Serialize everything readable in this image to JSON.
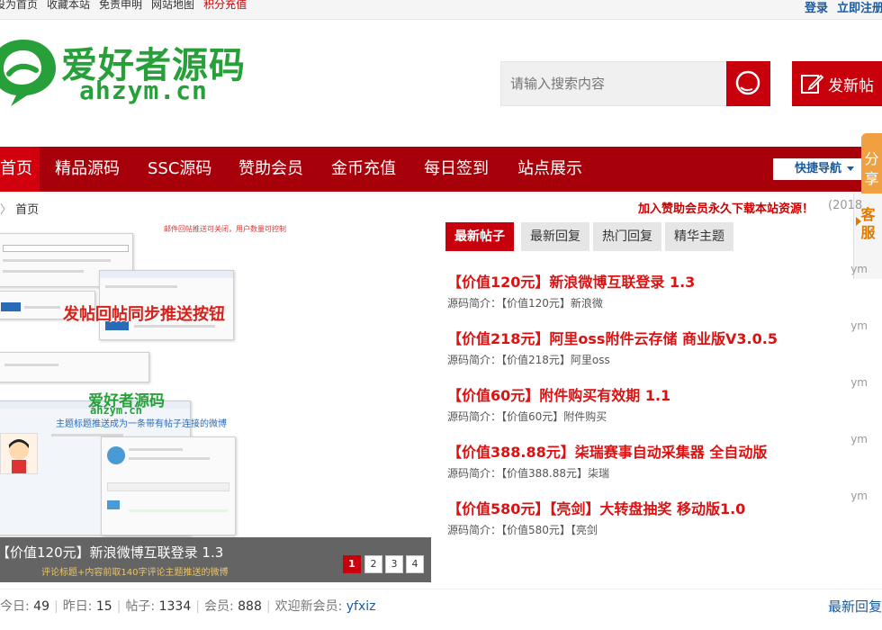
{
  "topbar": {
    "links": [
      "设为首页",
      "收藏本站",
      "免责申明",
      "网站地图",
      "积分充值"
    ],
    "login": "登录",
    "register": "立即注册"
  },
  "logo": {
    "cn": "爱好者源码",
    "en": "ahzym.cn"
  },
  "search": {
    "placeholder": "请输入搜索内容"
  },
  "post_button": "发新帖",
  "nav": {
    "items": [
      "首页",
      "精品源码",
      "SSC源码",
      "赞助会员",
      "金币充值",
      "每日签到",
      "站点展示"
    ],
    "quick": "快捷导航"
  },
  "side": {
    "share": "分享",
    "service": "客服"
  },
  "breadcrumb": "首页",
  "announcement": "加入赞助会员永久下载本站资源！",
  "announcement_date": "(2018",
  "slider": {
    "caption": "【价值120元】新浪微博互联登录 1.3",
    "caption_sub": "评论标题+内容前取140字评论主题推送的微博",
    "hint": "邮件回帖推送可关闭，用户数量可控制",
    "image_text_main": "发帖回帖同步推送按钮",
    "image_text_note": "主题标题推送成为一条带有帖子连接的微博",
    "watermark_cn": "爱好者源码",
    "watermark_en": "ahzym.cn",
    "pages": [
      "1",
      "2",
      "3",
      "4"
    ]
  },
  "tabs": [
    "最新帖子",
    "最新回复",
    "热门回复",
    "精华主题"
  ],
  "posts": [
    {
      "title": "【价值120元】新浪微博互联登录 1.3",
      "intro": "源码简介：【价值120元】新浪微",
      "author": "ym"
    },
    {
      "title": "【价值218元】阿里oss附件云存储 商业版V3.0.5",
      "intro": "源码简介：【价值218元】阿里oss",
      "author": "ym"
    },
    {
      "title": "【价值60元】附件购买有效期 1.1",
      "intro": "源码简介：【价值60元】附件购买",
      "author": "ym"
    },
    {
      "title": "【价值388.88元】柒瑞赛事自动采集器 全自动版",
      "intro": "源码简介：【价值388.88元】柒瑞",
      "author": "ym"
    },
    {
      "title": "【价值580元】【亮剑】大转盘抽奖 移动版1.0",
      "intro": "源码简介：【价值580元】【亮剑",
      "author": "ym"
    }
  ],
  "stats": {
    "today_label": "今日:",
    "today": "49",
    "yesterday_label": "昨日:",
    "yesterday": "15",
    "posts_label": "帖子:",
    "posts": "1334",
    "members_label": "会员:",
    "members": "888",
    "welcome_label": "欢迎新会员:",
    "new_member": "yfxiz",
    "right_link": "最新回复"
  },
  "colors": {
    "brand_red": "#c8000b",
    "nav_bg": "#a8000a",
    "logo_green": "#27a03a",
    "link_blue": "#1a5a9e"
  }
}
